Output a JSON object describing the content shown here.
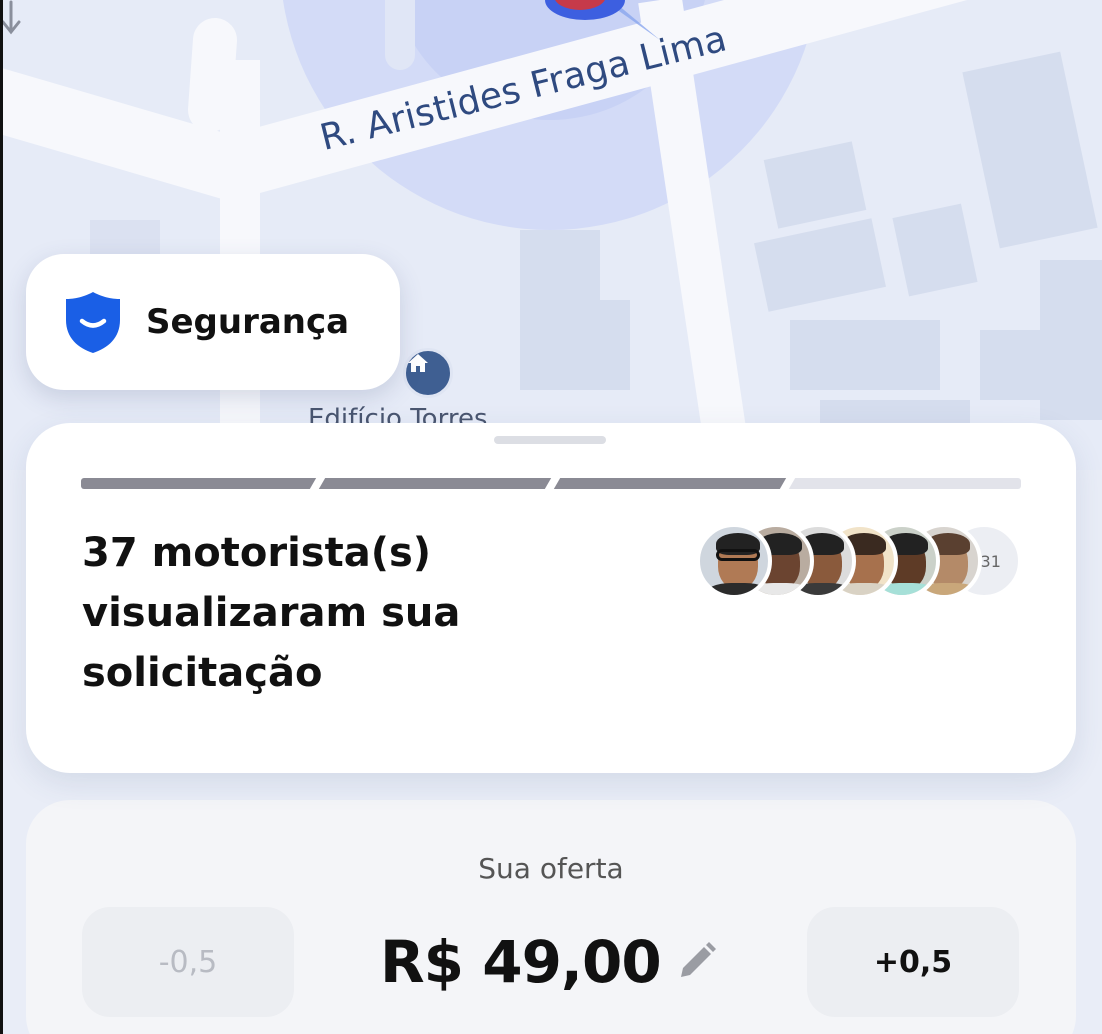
{
  "map": {
    "street_name": "R. Aristides Fraga Lima",
    "poi_label": "Edifício Torres",
    "poi_icon": "home-icon",
    "direction_icon": "arrow-down-icon"
  },
  "safety": {
    "label": "Segurança",
    "icon": "shield-icon",
    "icon_color": "#1a5fe6"
  },
  "status_card": {
    "progress_segments": [
      {
        "filled": true
      },
      {
        "filled": true
      },
      {
        "filled": true
      },
      {
        "filled": false
      }
    ],
    "headline": "37 motorista(s) visualizaram sua solicitação",
    "driver_avatars": [
      {
        "icon": "driver-avatar"
      },
      {
        "icon": "driver-avatar"
      },
      {
        "icon": "driver-avatar"
      },
      {
        "icon": "driver-avatar"
      },
      {
        "icon": "driver-avatar"
      },
      {
        "icon": "driver-avatar"
      }
    ],
    "more_count_label": "+31"
  },
  "offer": {
    "title": "Sua oferta",
    "decrease_label": "-0,5",
    "increase_label": "+0,5",
    "price": "R$ 49,00",
    "edit_icon": "pencil-icon"
  }
}
